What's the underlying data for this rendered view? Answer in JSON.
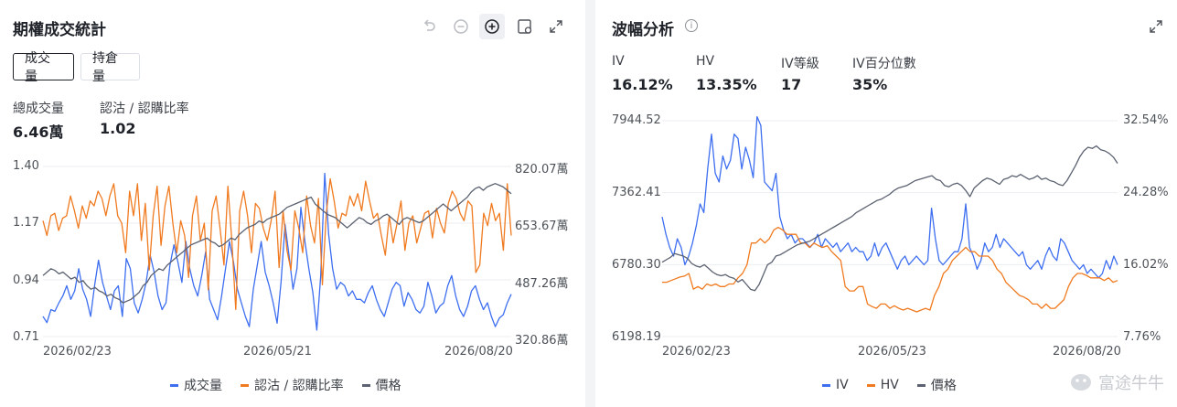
{
  "left": {
    "title": "期權成交統計",
    "toolbar": [
      "undo-icon",
      "zoom-out-icon",
      "zoom-in-icon",
      "settings-icon",
      "expand-icon"
    ],
    "tabs": [
      {
        "label": "成交量",
        "selected": true
      },
      {
        "label": "持倉量",
        "selected": false
      }
    ],
    "stats": [
      {
        "label": "總成交量",
        "value": "6.46萬"
      },
      {
        "label": "認沽 / 認購比率",
        "value": "1.02"
      }
    ],
    "y_left_ticks": [
      "1.40",
      "1.17",
      "0.94",
      "0.71"
    ],
    "y_right_ticks": [
      "820.07萬",
      "653.67萬",
      "487.26萬",
      "320.86萬"
    ],
    "x_ticks": [
      "2026/02/23",
      "2026/05/21",
      "2026/08/20"
    ],
    "legend": [
      {
        "label": "成交量",
        "color": "#3d6ef0"
      },
      {
        "label": "認沽 / 認購比率",
        "color": "#f07a1f"
      },
      {
        "label": "價格",
        "color": "#5b6170"
      }
    ]
  },
  "right": {
    "title": "波幅分析",
    "stats": [
      {
        "label": "IV",
        "value": "16.12%"
      },
      {
        "label": "HV",
        "value": "13.35%"
      },
      {
        "label": "IV等級",
        "value": "17"
      },
      {
        "label": "IV百分位數",
        "value": "35%"
      }
    ],
    "y_left_ticks": [
      "7944.52",
      "7362.41",
      "6780.30",
      "6198.19"
    ],
    "y_right_ticks": [
      "32.54%",
      "24.28%",
      "16.02%",
      "7.76%"
    ],
    "x_ticks": [
      "2026/02/23",
      "2026/05/23",
      "2026/08/20"
    ],
    "legend": [
      {
        "label": "IV",
        "color": "#3d6ef0"
      },
      {
        "label": "HV",
        "color": "#f07a1f"
      },
      {
        "label": "價格",
        "color": "#5b6170"
      }
    ]
  },
  "watermark": "富途牛牛",
  "chart_data": [
    {
      "type": "line",
      "x_start": "2026/02/23",
      "x_end": "2026/08/20",
      "series": [
        {
          "name": "成交量",
          "axis": "right",
          "color": "#3d6ef0",
          "values": [
            380,
            362,
            400,
            395,
            420,
            440,
            470,
            430,
            455,
            520,
            460,
            430,
            380,
            470,
            545,
            480,
            440,
            400,
            455,
            470,
            380,
            550,
            520,
            420,
            390,
            430,
            480,
            560,
            510,
            440,
            400,
            420,
            530,
            590,
            540,
            480,
            600,
            520,
            470,
            440,
            500,
            570,
            430,
            400,
            370,
            440,
            520,
            600,
            540,
            460,
            420,
            380,
            350,
            460,
            530,
            600,
            510,
            470,
            420,
            360,
            480,
            650,
            560,
            460,
            520,
            700,
            600,
            520,
            450,
            340,
            500,
            800,
            620,
            520,
            460,
            480,
            470,
            440,
            455,
            430,
            430,
            420,
            450,
            470,
            430,
            400,
            380,
            420,
            460,
            480,
            470,
            410,
            450,
            430,
            400,
            390,
            410,
            480,
            440,
            390,
            410,
            420,
            470,
            500,
            440,
            400,
            380,
            410,
            455,
            470,
            430,
            400,
            420,
            380,
            350,
            375,
            385,
            420,
            445
          ]
        },
        {
          "name": "認沽 / 認購比率",
          "axis": "left",
          "color": "#f07a1f",
          "values": [
            1.18,
            1.12,
            1.2,
            1.21,
            1.14,
            1.19,
            1.2,
            1.28,
            1.22,
            1.15,
            1.24,
            1.19,
            1.26,
            1.24,
            1.3,
            1.27,
            1.2,
            1.28,
            1.33,
            1.2,
            1.17,
            1.05,
            1.3,
            1.2,
            1.33,
            1.1,
            1.25,
            0.98,
            1.2,
            1.32,
            1.08,
            1.24,
            1.32,
            1.17,
            1.05,
            1.18,
            1.12,
            0.95,
            1.2,
            1.28,
            1.1,
            1.17,
            0.9,
            1.22,
            1.28,
            1.15,
            1.0,
            1.32,
            1.1,
            0.82,
            1.22,
            1.3,
            1.2,
            1.05,
            1.25,
            1.23,
            1.15,
            1.1,
            1.18,
            1.3,
            0.99,
            1.22,
            1.06,
            0.98,
            1.22,
            1.15,
            1.05,
            1.28,
            1.16,
            1.09,
            1.27,
            0.92,
            1.21,
            1.35,
            1.26,
            1.15,
            1.21,
            1.2,
            1.28,
            1.24,
            1.29,
            1.22,
            1.34,
            1.26,
            1.19,
            1.21,
            1.12,
            1.04,
            1.2,
            1.09,
            1.17,
            1.26,
            1.06,
            1.17,
            1.2,
            1.09,
            1.15,
            1.21,
            1.22,
            1.11,
            1.23,
            1.17,
            1.13,
            1.25,
            1.3,
            1.27,
            1.21,
            1.18,
            1.26,
            1.24,
            0.97,
            1.0,
            1.21,
            1.16,
            1.25,
            1.18,
            1.21,
            1.06,
            1.33,
            1.12
          ]
        },
        {
          "name": "價格",
          "axis": "right",
          "color": "#5b6170",
          "values": [
            500,
            510,
            520,
            515,
            505,
            510,
            500,
            490,
            495,
            480,
            485,
            470,
            460,
            465,
            455,
            450,
            440,
            445,
            435,
            430,
            420,
            425,
            430,
            440,
            450,
            470,
            480,
            500,
            510,
            520,
            515,
            530,
            540,
            550,
            560,
            570,
            580,
            590,
            595,
            600,
            605,
            610,
            600,
            595,
            585,
            590,
            600,
            610,
            605,
            620,
            630,
            640,
            645,
            650,
            660,
            655,
            665,
            670,
            675,
            680,
            690,
            700,
            705,
            710,
            715,
            720,
            725,
            730,
            710,
            700,
            690,
            680,
            675,
            670,
            660,
            650,
            640,
            650,
            660,
            670,
            665,
            655,
            650,
            660,
            665,
            675,
            680,
            670,
            660,
            650,
            665,
            670,
            665,
            660,
            655,
            660,
            670,
            680,
            690,
            700,
            710,
            700,
            690,
            700,
            710,
            720,
            730,
            745,
            755,
            760,
            750,
            760,
            765,
            770,
            765,
            760,
            750,
            740
          ]
        }
      ]
    },
    {
      "type": "line",
      "x_start": "2026/02/23",
      "x_end": "2026/08/20",
      "series": [
        {
          "name": "IV",
          "axis": "right",
          "color": "#3d6ef0",
          "values": [
            21.5,
            19.5,
            18.0,
            17.0,
            19.0,
            18.0,
            16.0,
            17.0,
            18.5,
            20.5,
            23.0,
            22.0,
            27.0,
            31.0,
            26.5,
            25.5,
            28.5,
            27.0,
            28.0,
            31.0,
            30.5,
            27.0,
            29.5,
            28.0,
            26.0,
            33.0,
            32.0,
            25.5,
            25.0,
            24.5,
            26.5,
            21.5,
            20.0,
            19.0,
            19.5,
            18.5,
            19.0,
            19.0,
            18.5,
            18.0,
            18.5,
            19.5,
            18.0,
            19.0,
            18.5,
            18.0,
            18.5,
            17.5,
            18.0,
            18.5,
            17.5,
            18.0,
            17.5,
            17.5,
            16.5,
            17.0,
            18.5,
            17.0,
            18.0,
            18.5,
            17.5,
            16.5,
            15.5,
            16.5,
            17.0,
            16.0,
            16.5,
            17.0,
            16.5,
            16.0,
            16.5,
            22.5,
            19.0,
            16.5,
            16.0,
            16.5,
            17.0,
            17.5,
            17.5,
            19.0,
            23.0,
            18.0,
            17.0,
            15.5,
            16.5,
            18.5,
            17.5,
            18.0,
            19.5,
            18.0,
            19.0,
            18.5,
            18.0,
            17.5,
            17.0,
            17.5,
            16.0,
            15.5,
            16.0,
            16.5,
            15.5,
            17.0,
            18.0,
            17.0,
            16.5,
            19.0,
            18.5,
            17.5,
            16.5,
            16.0,
            15.5,
            16.0,
            15.0,
            15.5,
            15.0,
            14.5,
            15.0,
            16.5,
            15.5,
            17.0,
            16.0
          ]
        },
        {
          "name": "HV",
          "axis": "right",
          "color": "#f07a1f",
          "values": [
            14.0,
            14.0,
            14.2,
            14.4,
            14.6,
            14.7,
            15.0,
            13.2,
            13.5,
            13.2,
            13.8,
            13.6,
            13.8,
            13.5,
            13.5,
            13.8,
            13.8,
            14.5,
            15.0,
            16.0,
            18.5,
            18.5,
            19.0,
            18.5,
            19.0,
            20.0,
            20.3,
            20.0,
            19.5,
            19.5,
            19.5,
            18.5,
            18.5,
            18.0,
            18.5,
            18.2,
            18.0,
            18.2,
            17.5,
            17.0,
            16.5,
            13.5,
            13.0,
            13.0,
            13.5,
            13.5,
            11.5,
            11.2,
            11.0,
            11.5,
            11.5,
            11.0,
            11.3,
            11.0,
            10.8,
            11.0,
            10.8,
            10.6,
            10.8,
            11.0,
            10.8,
            12.5,
            13.5,
            15.0,
            15.5,
            16.5,
            17.0,
            17.5,
            18.0,
            17.5,
            17.5,
            17.0,
            17.0,
            17.0,
            16.5,
            15.5,
            15.0,
            14.0,
            13.5,
            13.0,
            12.5,
            12.3,
            12.0,
            11.5,
            11.5,
            11.0,
            11.5,
            11.0,
            11.0,
            11.5,
            12.0,
            13.5,
            14.5,
            15.0,
            15.0,
            14.8,
            14.5,
            14.5,
            14.5,
            14.2,
            14.5,
            14.0,
            14.2
          ]
        },
        {
          "name": "價格",
          "axis": "left",
          "color": "#5b6170",
          "values": [
            6800,
            6820,
            6840,
            6870,
            6860,
            6850,
            6830,
            6790,
            6770,
            6760,
            6780,
            6750,
            6720,
            6700,
            6690,
            6700,
            6680,
            6670,
            6640,
            6660,
            6620,
            6580,
            6570,
            6620,
            6700,
            6780,
            6800,
            6850,
            6860,
            6880,
            6900,
            6920,
            6940,
            6950,
            6960,
            6970,
            6990,
            7010,
            7030,
            7050,
            7070,
            7090,
            7110,
            7130,
            7150,
            7170,
            7200,
            7220,
            7240,
            7260,
            7280,
            7300,
            7310,
            7330,
            7350,
            7380,
            7400,
            7410,
            7420,
            7440,
            7460,
            7470,
            7480,
            7490,
            7500,
            7470,
            7460,
            7420,
            7410,
            7430,
            7440,
            7420,
            7380,
            7330,
            7400,
            7430,
            7460,
            7480,
            7470,
            7450,
            7430,
            7470,
            7480,
            7500,
            7490,
            7510,
            7490,
            7470,
            7480,
            7500,
            7470,
            7480,
            7460,
            7450,
            7430,
            7420,
            7460,
            7520,
            7580,
            7650,
            7700,
            7730,
            7720,
            7740,
            7710,
            7700,
            7680,
            7650,
            7600
          ]
        }
      ]
    }
  ]
}
